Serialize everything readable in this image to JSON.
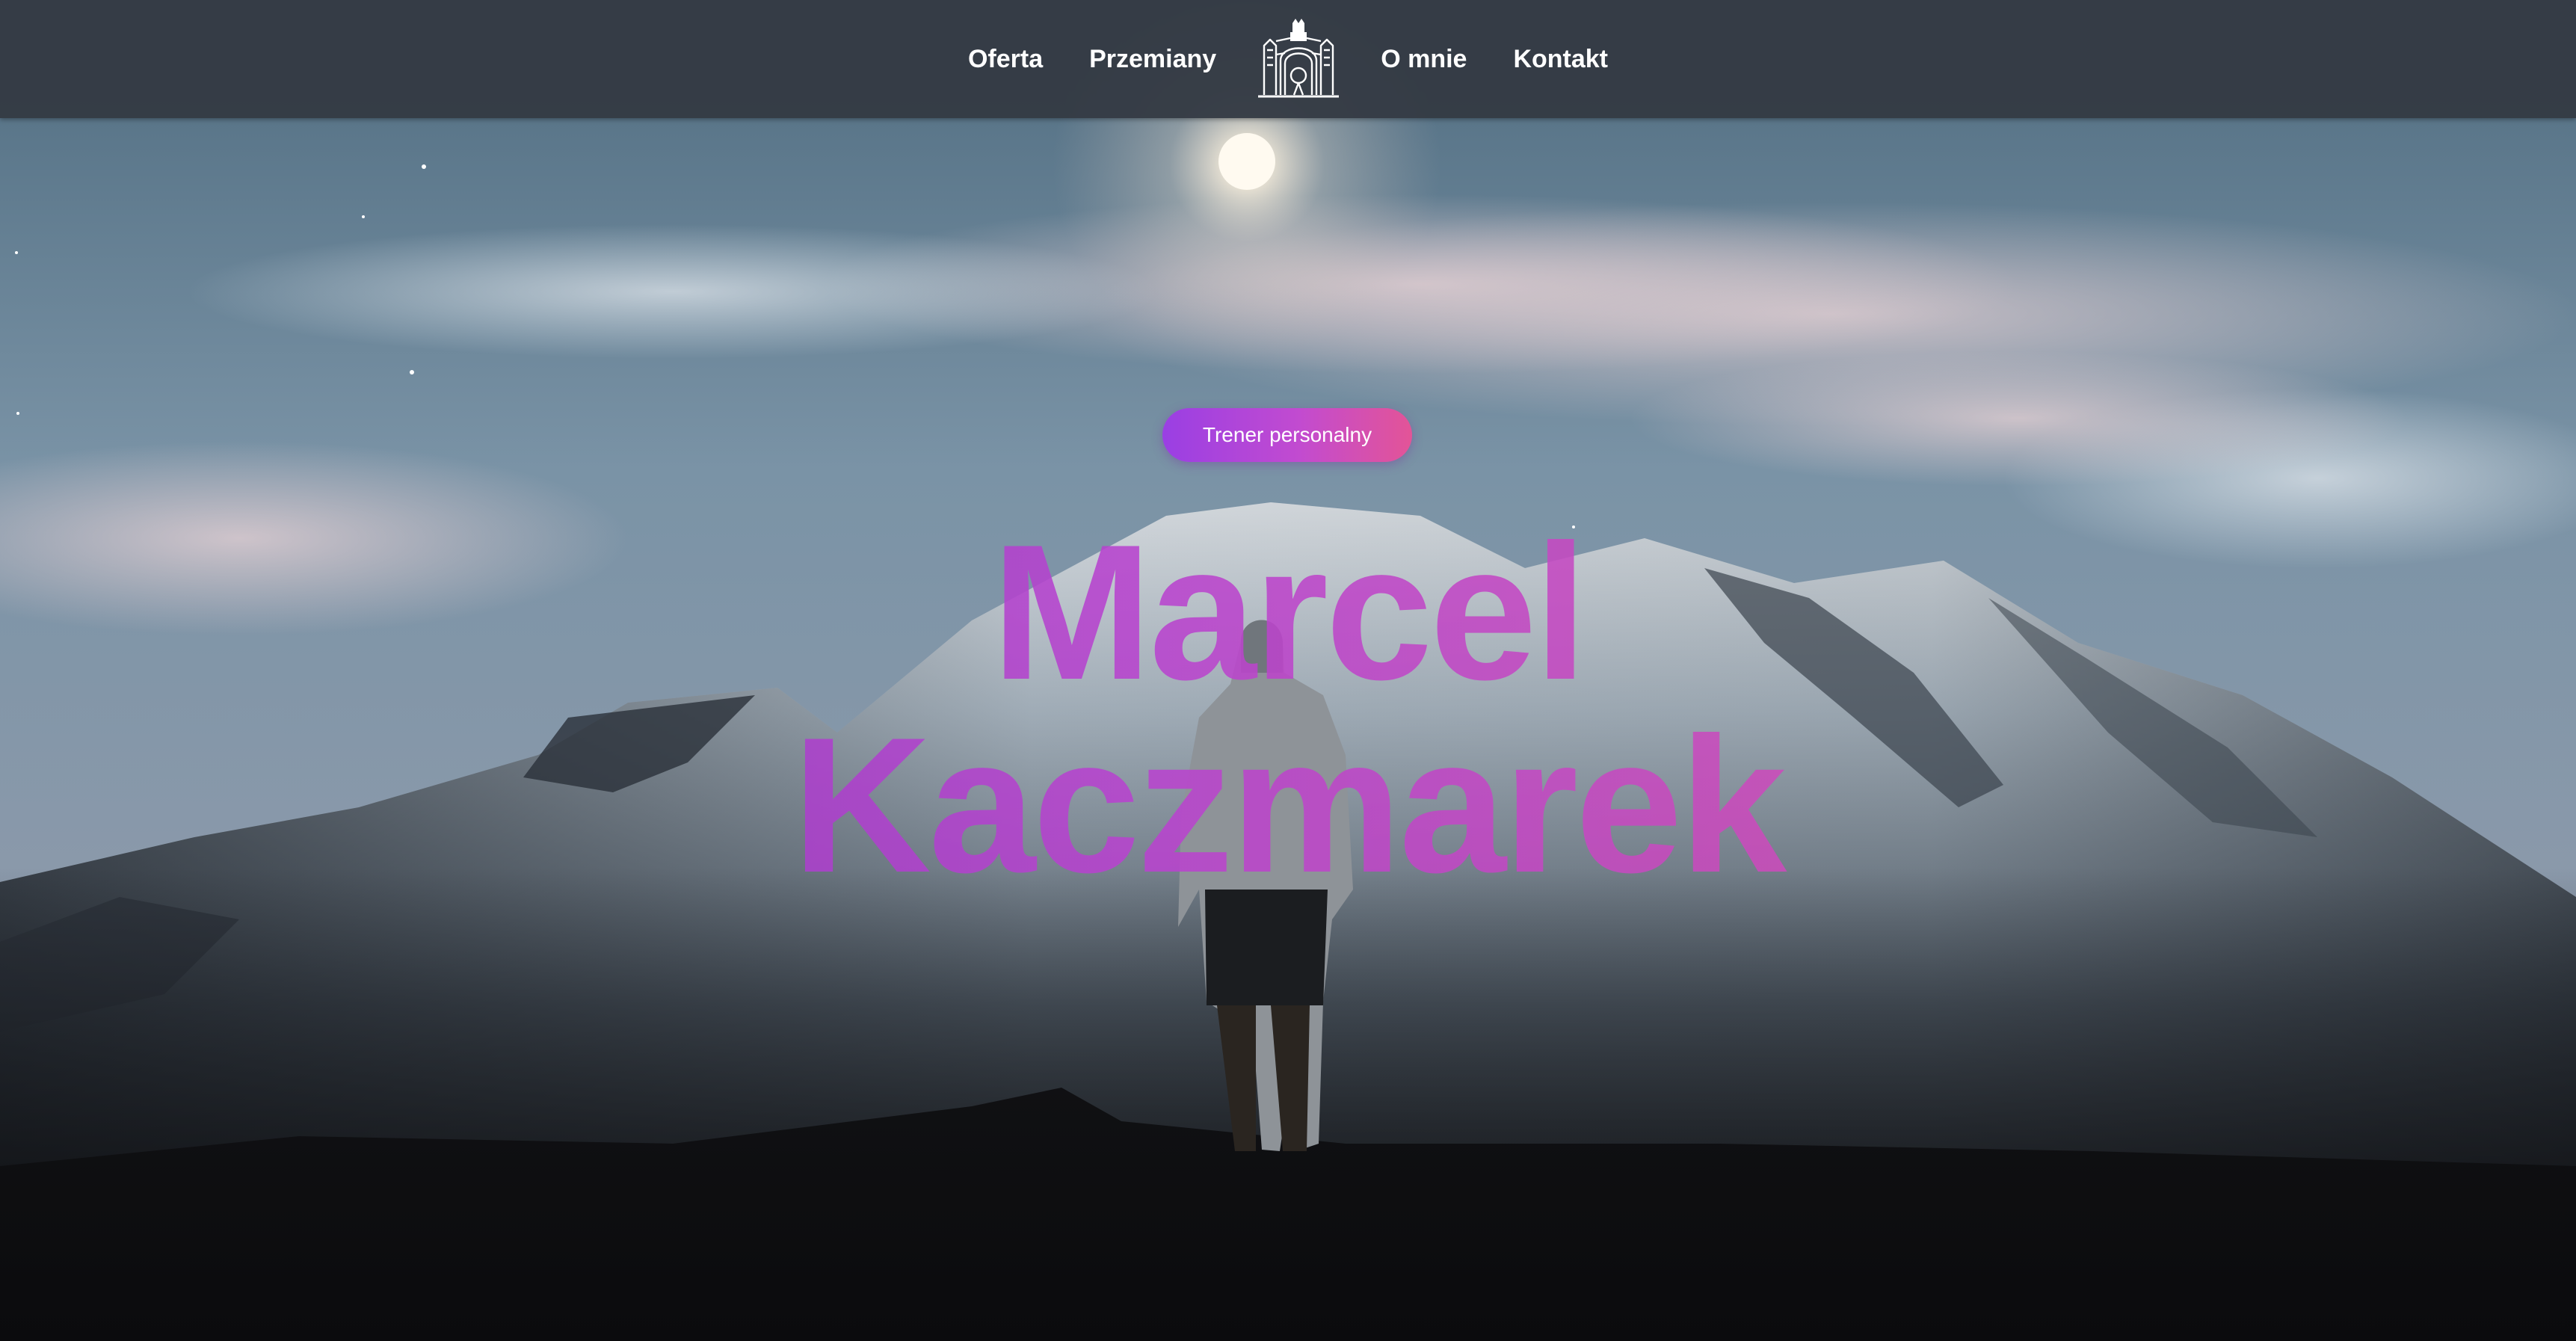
{
  "nav": {
    "items_left": [
      {
        "label": "Oferta"
      },
      {
        "label": "Przemiany"
      }
    ],
    "items_right": [
      {
        "label": "O mnie"
      },
      {
        "label": "Kontakt"
      }
    ],
    "logo_icon": "castle-gate-logo-icon"
  },
  "hero": {
    "badge": "Trener personalny",
    "title_line1": "Marcel",
    "title_line2": "Kaczmarek",
    "background_icon": "mountain-night-landscape-photo"
  },
  "colors": {
    "nav_background": "#343a44",
    "accent_start": "#9a3fe3",
    "accent_end": "#e35497",
    "title_gradient_start": "#9236c9",
    "title_gradient_end": "#d34b8f"
  }
}
